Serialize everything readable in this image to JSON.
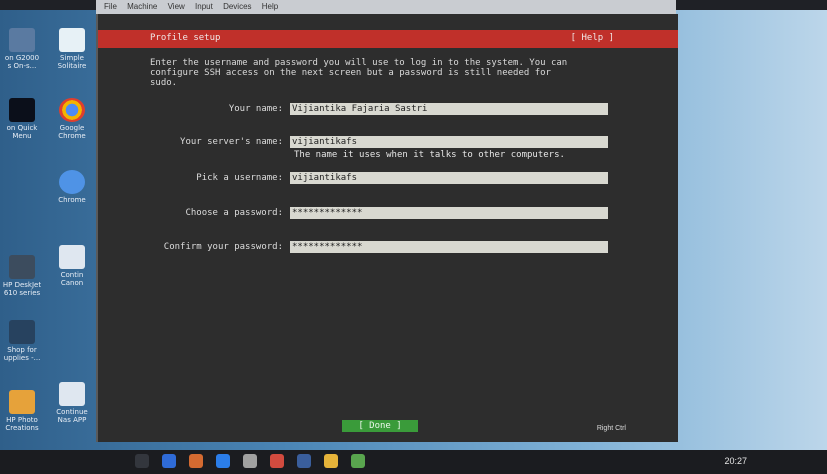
{
  "menubar": {
    "items": [
      "File",
      "Machine",
      "View",
      "Input",
      "Devices",
      "Help"
    ]
  },
  "desktop": {
    "icons": [
      {
        "label": "on G2000\ns On-s..."
      },
      {
        "label": "Simple\nSolitaire"
      },
      {
        "label": "on Quick\nMenu"
      },
      {
        "label": "Google\nChrome"
      },
      {
        "label": "Chrome"
      },
      {
        "label": "HP DeskJet\n610 series"
      },
      {
        "label": "Contin\nCanon"
      },
      {
        "label": "Shop for\nupplies -..."
      },
      {
        "label": "HP Photo\nCreations"
      },
      {
        "label": "Continue\nNas APP"
      }
    ]
  },
  "installer": {
    "title": "Profile setup",
    "help": "[ Help ]",
    "intro": "Enter the username and password you will use to log in to the system. You can\nconfigure SSH access on the next screen but a password is still needed for\nsudo.",
    "fields": {
      "your_name": {
        "label": "Your name:",
        "value": "Vijiantika Fajaria Sastri"
      },
      "server_name": {
        "label": "Your server's name:",
        "value": "vijiantikafs",
        "hint": "The name it uses when it talks to other computers."
      },
      "username": {
        "label": "Pick a username:",
        "value": "vijiantikafs"
      },
      "password": {
        "label": "Choose a password:",
        "value": "*************"
      },
      "confirm_password": {
        "label": "Confirm your password:",
        "value": "*************"
      }
    },
    "done_button": "[ Done ]"
  },
  "vm_status": {
    "host_key": "Right Ctrl"
  },
  "taskbar": {
    "time": "20:27"
  },
  "colors": {
    "title_bar": "#c0302a",
    "done_button": "#3a9b3a",
    "field_bg": "#d8d8d0"
  }
}
